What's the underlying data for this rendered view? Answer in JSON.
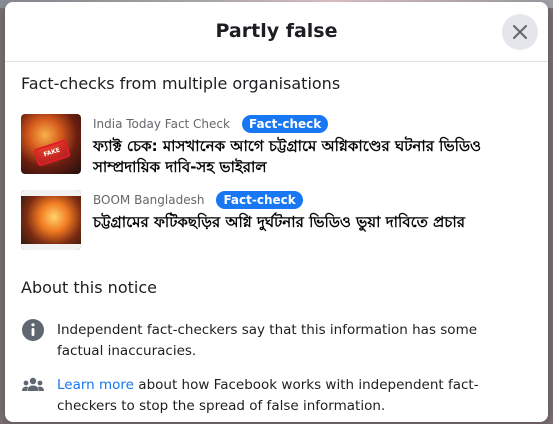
{
  "dialog": {
    "title": "Partly false",
    "close_icon": "close-icon"
  },
  "fact_checks": {
    "heading": "Fact-checks from multiple organisations",
    "items": [
      {
        "source": "India Today Fact Check",
        "badge": "Fact-check",
        "title": "ফ্যাক্ট চেক: মাসখানেক আগে চট্টগ্রামে অগ্নিকাণ্ডের ঘটনার ভিডিও সাম্প্রদায়িক দাবি-সহ ভাইরাল",
        "thumbnail_stamp": "FAKE"
      },
      {
        "source": "BOOM Bangladesh",
        "badge": "Fact-check",
        "title": "চট্টগ্রামের ফটিকছড়ির অগ্নি দুর্ঘটনার ভিডিও ভুয়া দাবিতে প্রচার"
      }
    ]
  },
  "about": {
    "heading": "About this notice",
    "info_text": "Independent fact-checkers say that this information has some factual inaccuracies.",
    "learn_more_link": "Learn more",
    "learn_more_rest": " about how Facebook works with independent fact-checkers to stop the spread of false information.",
    "icons": [
      "info-icon",
      "people-group-icon"
    ]
  },
  "colors": {
    "accent": "#1877f2",
    "text": "#1c1e21",
    "secondary": "#65676b"
  }
}
